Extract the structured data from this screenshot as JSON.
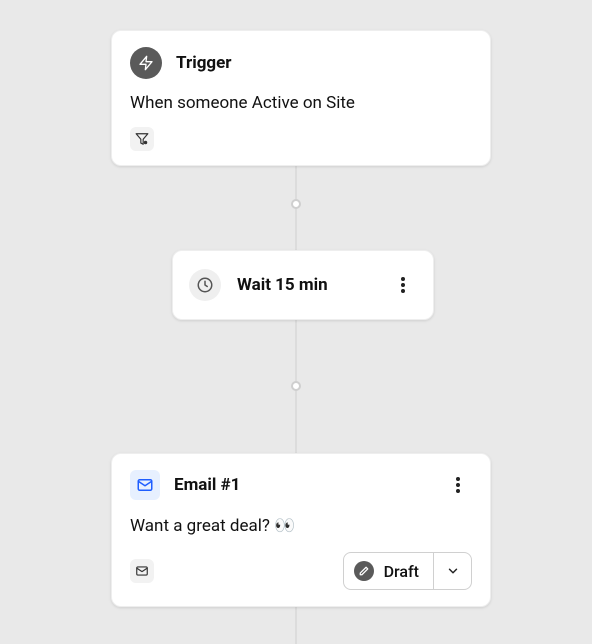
{
  "trigger": {
    "title": "Trigger",
    "description": "When someone Active on Site"
  },
  "wait": {
    "label": "Wait 15 min"
  },
  "email": {
    "title": "Email #1",
    "subject": "Want a great deal? 👀",
    "status": "Draft"
  }
}
